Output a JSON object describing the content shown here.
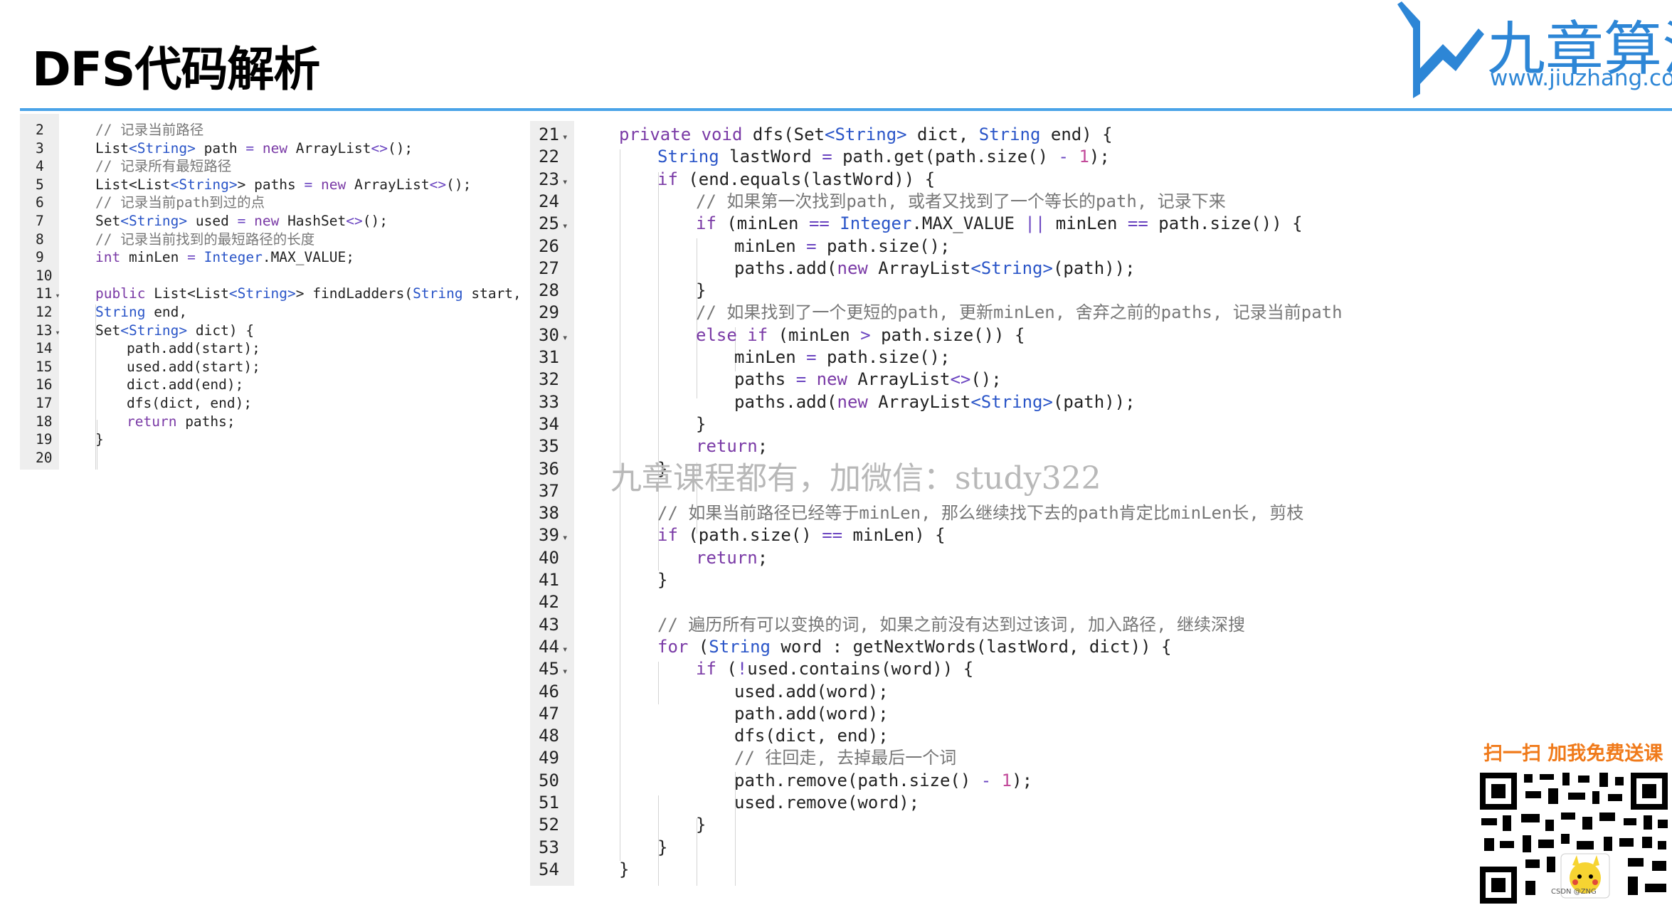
{
  "slide": {
    "title": "DFS代码解析"
  },
  "logo": {
    "cn": "九章算法",
    "url": "www.jiuzhang.com"
  },
  "watermark": "九章课程都有，加微信：study322",
  "promo": {
    "text": "扫一扫 加我免费送课",
    "qr_label": "CSDN @ZNG"
  },
  "colors": {
    "accent": "#4aa3e8",
    "keyword": "#7a3aa6",
    "type": "#2a55c8",
    "number": "#c24a9a",
    "comment": "#777777",
    "promo": "#f07a1a"
  },
  "left_editor": {
    "lines": [
      {
        "n": "2",
        "fold": false,
        "indent": 0,
        "code": [
          [
            "cm",
            "// 记录当前路径"
          ]
        ]
      },
      {
        "n": "3",
        "fold": false,
        "indent": 0,
        "code": [
          [
            "",
            "List"
          ],
          [
            "ty",
            "<String>"
          ],
          [
            "",
            " path "
          ],
          [
            "op",
            "="
          ],
          [
            "kw",
            " new"
          ],
          [
            "",
            " ArrayList"
          ],
          [
            "op",
            "<>"
          ],
          [
            "",
            "();"
          ]
        ]
      },
      {
        "n": "4",
        "fold": false,
        "indent": 0,
        "code": [
          [
            "cm",
            "// 记录所有最短路径"
          ]
        ]
      },
      {
        "n": "5",
        "fold": false,
        "indent": 0,
        "code": [
          [
            "",
            "List<List"
          ],
          [
            "ty",
            "<String>"
          ],
          [
            "",
            ">"
          ],
          [
            "",
            " paths "
          ],
          [
            "op",
            "="
          ],
          [
            "kw",
            " new"
          ],
          [
            "",
            " ArrayList"
          ],
          [
            "op",
            "<>"
          ],
          [
            "",
            "();"
          ]
        ]
      },
      {
        "n": "6",
        "fold": false,
        "indent": 0,
        "code": [
          [
            "cm",
            "// 记录当前path到过的点"
          ]
        ]
      },
      {
        "n": "7",
        "fold": false,
        "indent": 0,
        "code": [
          [
            "",
            "Set"
          ],
          [
            "ty",
            "<String>"
          ],
          [
            "",
            " used "
          ],
          [
            "op",
            "="
          ],
          [
            "kw",
            " new"
          ],
          [
            "",
            " HashSet"
          ],
          [
            "op",
            "<>"
          ],
          [
            "",
            "();"
          ]
        ]
      },
      {
        "n": "8",
        "fold": false,
        "indent": 0,
        "code": [
          [
            "cm",
            "// 记录当前找到的最短路径的长度"
          ]
        ]
      },
      {
        "n": "9",
        "fold": false,
        "indent": 0,
        "code": [
          [
            "kw",
            "int"
          ],
          [
            "",
            " minLen "
          ],
          [
            "op",
            "="
          ],
          [
            "ty",
            " Integer"
          ],
          [
            "",
            ".MAX_VALUE;"
          ]
        ]
      },
      {
        "n": "10",
        "fold": false,
        "indent": 0,
        "code": []
      },
      {
        "n": "11",
        "fold": true,
        "indent": 0,
        "code": [
          [
            "kw",
            "public"
          ],
          [
            "",
            " List<List"
          ],
          [
            "ty",
            "<String>"
          ],
          [
            "",
            ">"
          ],
          [
            "",
            " findLadders("
          ],
          [
            "ty",
            "String"
          ],
          [
            "",
            " start,"
          ]
        ]
      },
      {
        "n": "12",
        "fold": false,
        "indent": 0,
        "code": [
          [
            "ty",
            "String"
          ],
          [
            "",
            " end,"
          ]
        ]
      },
      {
        "n": "13",
        "fold": true,
        "indent": 0,
        "code": [
          [
            "",
            "Set"
          ],
          [
            "ty",
            "<String>"
          ],
          [
            "",
            " dict) {"
          ]
        ]
      },
      {
        "n": "14",
        "fold": false,
        "indent": 1,
        "code": [
          [
            "",
            "path.add(start);"
          ]
        ]
      },
      {
        "n": "15",
        "fold": false,
        "indent": 1,
        "code": [
          [
            "",
            "used.add(start);"
          ]
        ]
      },
      {
        "n": "16",
        "fold": false,
        "indent": 1,
        "code": [
          [
            "",
            "dict.add(end);"
          ]
        ]
      },
      {
        "n": "17",
        "fold": false,
        "indent": 1,
        "code": [
          [
            "",
            "dfs(dict, end);"
          ]
        ]
      },
      {
        "n": "18",
        "fold": false,
        "indent": 1,
        "code": [
          [
            "kw",
            "return"
          ],
          [
            "",
            " paths;"
          ]
        ]
      },
      {
        "n": "19",
        "fold": false,
        "indent": 0,
        "code": [
          [
            "",
            "}"
          ]
        ]
      },
      {
        "n": "20",
        "fold": false,
        "indent": 0,
        "code": []
      }
    ]
  },
  "right_editor": {
    "lines": [
      {
        "n": "21",
        "fold": true,
        "indent": 0,
        "code": [
          [
            "kw",
            "private"
          ],
          [
            "kw",
            " void"
          ],
          [
            "",
            " dfs(Set"
          ],
          [
            "ty",
            "<String>"
          ],
          [
            "",
            " dict, "
          ],
          [
            "ty",
            "String"
          ],
          [
            "",
            " end) {"
          ]
        ]
      },
      {
        "n": "22",
        "fold": false,
        "indent": 1,
        "code": [
          [
            "ty",
            "String"
          ],
          [
            "",
            " lastWord "
          ],
          [
            "op",
            "="
          ],
          [
            "",
            " path.get(path.size() "
          ],
          [
            "op",
            "-"
          ],
          [
            "num",
            " 1"
          ],
          [
            "",
            ");"
          ]
        ]
      },
      {
        "n": "23",
        "fold": true,
        "indent": 1,
        "code": [
          [
            "kw",
            "if"
          ],
          [
            "",
            " (end.equals(lastWord)) {"
          ]
        ]
      },
      {
        "n": "24",
        "fold": false,
        "indent": 2,
        "code": [
          [
            "cm",
            "// 如果第一次找到path, 或者又找到了一个等长的path, 记录下来"
          ]
        ]
      },
      {
        "n": "25",
        "fold": true,
        "indent": 2,
        "code": [
          [
            "kw",
            "if"
          ],
          [
            "",
            " (minLen "
          ],
          [
            "op",
            "=="
          ],
          [
            "ty",
            " Integer"
          ],
          [
            "",
            ".MAX_VALUE "
          ],
          [
            "op",
            "||"
          ],
          [
            "",
            " minLen "
          ],
          [
            "op",
            "=="
          ],
          [
            "",
            " path.size()) {"
          ]
        ]
      },
      {
        "n": "26",
        "fold": false,
        "indent": 3,
        "code": [
          [
            "",
            "minLen "
          ],
          [
            "op",
            "="
          ],
          [
            "",
            " path.size();"
          ]
        ]
      },
      {
        "n": "27",
        "fold": false,
        "indent": 3,
        "code": [
          [
            "",
            "paths.add("
          ],
          [
            "kw",
            "new"
          ],
          [
            "",
            " ArrayList"
          ],
          [
            "ty",
            "<String>"
          ],
          [
            "",
            "(path));"
          ]
        ]
      },
      {
        "n": "28",
        "fold": false,
        "indent": 2,
        "code": [
          [
            "",
            "}"
          ]
        ]
      },
      {
        "n": "29",
        "fold": false,
        "indent": 2,
        "code": [
          [
            "cm",
            "// 如果找到了一个更短的path, 更新minLen, 舍弃之前的paths, 记录当前path"
          ]
        ]
      },
      {
        "n": "30",
        "fold": true,
        "indent": 2,
        "code": [
          [
            "kw",
            "else if"
          ],
          [
            "",
            " (minLen "
          ],
          [
            "op",
            ">"
          ],
          [
            "",
            " path.size()) {"
          ]
        ]
      },
      {
        "n": "31",
        "fold": false,
        "indent": 3,
        "code": [
          [
            "",
            "minLen "
          ],
          [
            "op",
            "="
          ],
          [
            "",
            " path.size();"
          ]
        ]
      },
      {
        "n": "32",
        "fold": false,
        "indent": 3,
        "code": [
          [
            "",
            "paths "
          ],
          [
            "op",
            "="
          ],
          [
            "kw",
            " new"
          ],
          [
            "",
            " ArrayList"
          ],
          [
            "op",
            "<>"
          ],
          [
            "",
            "();"
          ]
        ]
      },
      {
        "n": "33",
        "fold": false,
        "indent": 3,
        "code": [
          [
            "",
            "paths.add("
          ],
          [
            "kw",
            "new"
          ],
          [
            "",
            " ArrayList"
          ],
          [
            "ty",
            "<String>"
          ],
          [
            "",
            "(path));"
          ]
        ]
      },
      {
        "n": "34",
        "fold": false,
        "indent": 2,
        "code": [
          [
            "",
            "}"
          ]
        ]
      },
      {
        "n": "35",
        "fold": false,
        "indent": 2,
        "code": [
          [
            "kw",
            "return"
          ],
          [
            "",
            ";"
          ]
        ]
      },
      {
        "n": "36",
        "fold": false,
        "indent": 1,
        "code": [
          [
            "",
            "}"
          ]
        ]
      },
      {
        "n": "37",
        "fold": false,
        "indent": 0,
        "code": []
      },
      {
        "n": "38",
        "fold": false,
        "indent": 1,
        "code": [
          [
            "cm",
            "// 如果当前路径已经等于minLen, 那么继续找下去的path肯定比minLen长, 剪枝"
          ]
        ]
      },
      {
        "n": "39",
        "fold": true,
        "indent": 1,
        "code": [
          [
            "kw",
            "if"
          ],
          [
            "",
            " (path.size() "
          ],
          [
            "op",
            "=="
          ],
          [
            "",
            " minLen) {"
          ]
        ]
      },
      {
        "n": "40",
        "fold": false,
        "indent": 2,
        "code": [
          [
            "kw",
            "return"
          ],
          [
            "",
            ";"
          ]
        ]
      },
      {
        "n": "41",
        "fold": false,
        "indent": 1,
        "code": [
          [
            "",
            "}"
          ]
        ]
      },
      {
        "n": "42",
        "fold": false,
        "indent": 0,
        "code": []
      },
      {
        "n": "43",
        "fold": false,
        "indent": 1,
        "code": [
          [
            "cm",
            "// 遍历所有可以变换的词, 如果之前没有达到过该词, 加入路径, 继续深搜"
          ]
        ]
      },
      {
        "n": "44",
        "fold": true,
        "indent": 1,
        "code": [
          [
            "kw",
            "for"
          ],
          [
            "",
            " ("
          ],
          [
            "ty",
            "String"
          ],
          [
            "",
            " word : getNextWords(lastWord, dict)) {"
          ]
        ]
      },
      {
        "n": "45",
        "fold": true,
        "indent": 2,
        "code": [
          [
            "kw",
            "if"
          ],
          [
            "",
            " ("
          ],
          [
            "op",
            "!"
          ],
          [
            "",
            "used.contains(word)) {"
          ]
        ]
      },
      {
        "n": "46",
        "fold": false,
        "indent": 3,
        "code": [
          [
            "",
            "used.add(word);"
          ]
        ]
      },
      {
        "n": "47",
        "fold": false,
        "indent": 3,
        "code": [
          [
            "",
            "path.add(word);"
          ]
        ]
      },
      {
        "n": "48",
        "fold": false,
        "indent": 3,
        "code": [
          [
            "",
            "dfs(dict, end);"
          ]
        ]
      },
      {
        "n": "49",
        "fold": false,
        "indent": 3,
        "code": [
          [
            "cm",
            "// 往回走, 去掉最后一个词"
          ]
        ]
      },
      {
        "n": "50",
        "fold": false,
        "indent": 3,
        "code": [
          [
            "",
            "path.remove(path.size() "
          ],
          [
            "op",
            "-"
          ],
          [
            "num",
            " 1"
          ],
          [
            "",
            ");"
          ]
        ]
      },
      {
        "n": "51",
        "fold": false,
        "indent": 3,
        "code": [
          [
            "",
            "used.remove(word);"
          ]
        ]
      },
      {
        "n": "52",
        "fold": false,
        "indent": 2,
        "code": [
          [
            "",
            "}"
          ]
        ]
      },
      {
        "n": "53",
        "fold": false,
        "indent": 1,
        "code": [
          [
            "",
            "}"
          ]
        ]
      },
      {
        "n": "54",
        "fold": false,
        "indent": 0,
        "code": [
          [
            "",
            "}"
          ]
        ]
      }
    ]
  }
}
